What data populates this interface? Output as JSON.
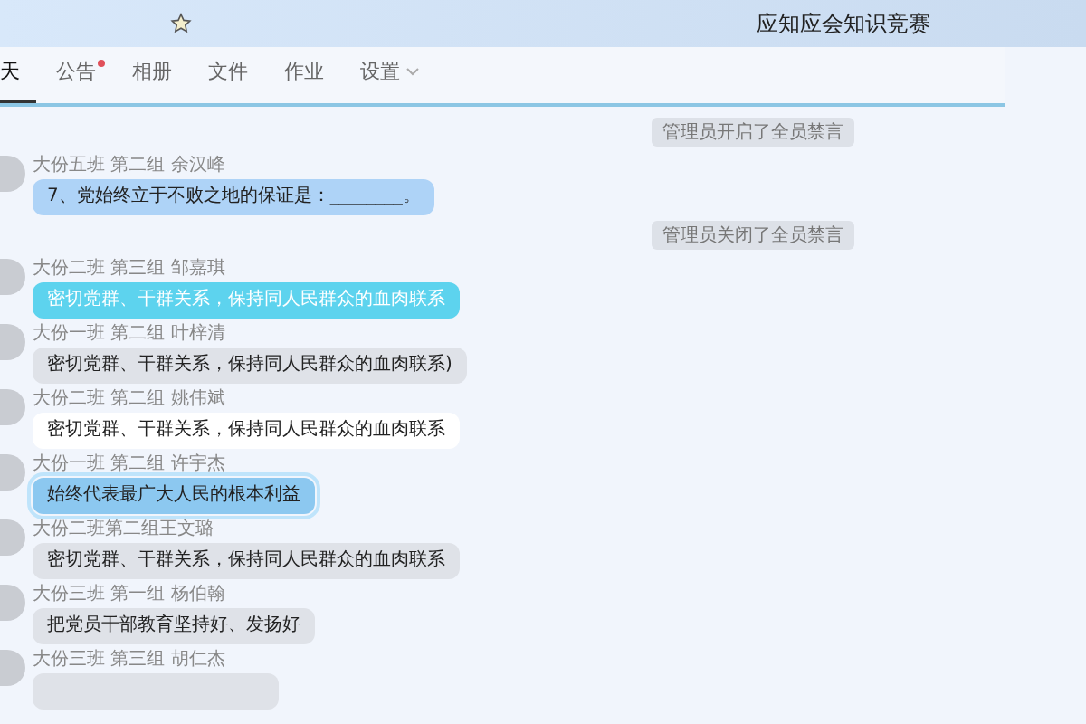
{
  "window": {
    "title": "应知应会知识竞赛"
  },
  "tabs": [
    {
      "label": "天",
      "selected": true,
      "dot": false,
      "menu": false
    },
    {
      "label": "公告",
      "selected": false,
      "dot": true,
      "menu": false
    },
    {
      "label": "相册",
      "selected": false,
      "dot": false,
      "menu": false
    },
    {
      "label": "文件",
      "selected": false,
      "dot": false,
      "menu": false
    },
    {
      "label": "作业",
      "selected": false,
      "dot": false,
      "menu": false
    },
    {
      "label": "设置",
      "selected": false,
      "dot": false,
      "menu": true
    }
  ],
  "feed": [
    {
      "kind": "notice",
      "text": "管理员开启了全员禁言"
    },
    {
      "kind": "message",
      "sender": "大份五班 第二组 余汉峰",
      "text": "7、党始终立于不败之地的保证是：________。",
      "color": "#aed3f7",
      "selected": false
    },
    {
      "kind": "notice",
      "text": "管理员关闭了全员禁言"
    },
    {
      "kind": "message",
      "sender": "大份二班 第三组 邹嘉琪",
      "text": "密切党群、干群关系，保持同人民群众的血肉联系",
      "color": "#5dd3ee",
      "selected": false
    },
    {
      "kind": "message",
      "sender": "大份一班 第二组 叶梓清",
      "text": "密切党群、干群关系，保持同人民群众的血肉联系)",
      "color": "#dfe2e8",
      "selected": false
    },
    {
      "kind": "message",
      "sender": "大份二班 第二组 姚伟斌",
      "text": "密切党群、干群关系，保持同人民群众的血肉联系",
      "color": "#ffffff",
      "selected": false
    },
    {
      "kind": "message",
      "sender": "大份一班 第二组 许宇杰",
      "text": "始终代表最广大人民的根本利益",
      "color": "#8cc8f0",
      "selected": true
    },
    {
      "kind": "message",
      "sender": "大份二班第二组王文璐",
      "text": "密切党群、干群关系，保持同人民群众的血肉联系",
      "color": "#dfe2e8",
      "selected": false
    },
    {
      "kind": "message",
      "sender": "大份三班 第一组 杨伯翰",
      "text": "把党员干部教育坚持好、发扬好",
      "color": "#dfe2e8",
      "selected": false
    },
    {
      "kind": "message",
      "sender": "大份三班 第三组 胡仁杰",
      "color": "#dfe2e8",
      "selected": false
    }
  ]
}
